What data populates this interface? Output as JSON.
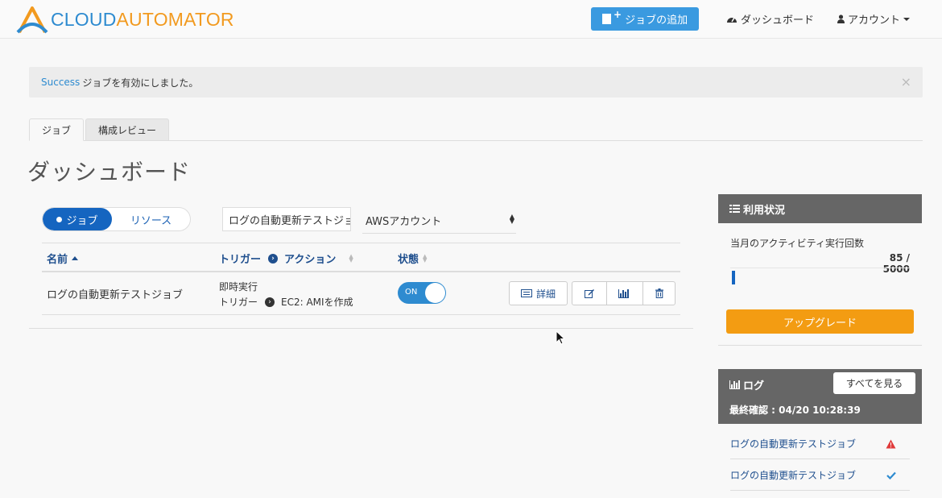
{
  "brand": {
    "part1": "CLOUD",
    "part2": "AUTOMATOR"
  },
  "nav": {
    "add_job": "ジョブの追加",
    "dashboard": "ダッシュボード",
    "account": "アカウント"
  },
  "alert": {
    "prefix": "Success",
    "message": "ジョブを有効にしました。",
    "close": "×"
  },
  "tabs": [
    {
      "label": "ジョブ"
    },
    {
      "label": "構成レビュー"
    }
  ],
  "page_title": "ダッシュボード",
  "view_toggle": {
    "jobs": "ジョブ",
    "resources": "リソース"
  },
  "filter": {
    "value": "ログの自動更新テストジョブ"
  },
  "account_select": {
    "value": "AWSアカウント"
  },
  "table": {
    "headers": {
      "name": "名前",
      "trigger": "トリガー",
      "action": "アクション",
      "state": "状態"
    },
    "rows": [
      {
        "name": "ログの自動更新テストジョブ",
        "trigger_line1": "即時実行",
        "trigger_line2": "トリガー",
        "action": "EC2: AMIを作成",
        "state": "ON",
        "detail_label": "詳細"
      }
    ]
  },
  "usage": {
    "title": "利用状況",
    "label": "当月のアクティビティ実行回数",
    "count": "85 / 5000",
    "fraction": 0.017,
    "upgrade": "アップグレード"
  },
  "log": {
    "title": "ログ",
    "see_all": "すべてを見る",
    "last_checked": "最終確認 : 04/20 10:28:39",
    "items": [
      {
        "name": "ログの自動更新テストジョブ",
        "status_icon": "warning-icon"
      },
      {
        "name": "ログの自動更新テストジョブ",
        "status_icon": "check-icon"
      }
    ]
  },
  "colors": {
    "primary": "#1565c0",
    "accent": "#3a9ae0",
    "upgrade": "#f39c12",
    "warning": "#e03a3a"
  }
}
